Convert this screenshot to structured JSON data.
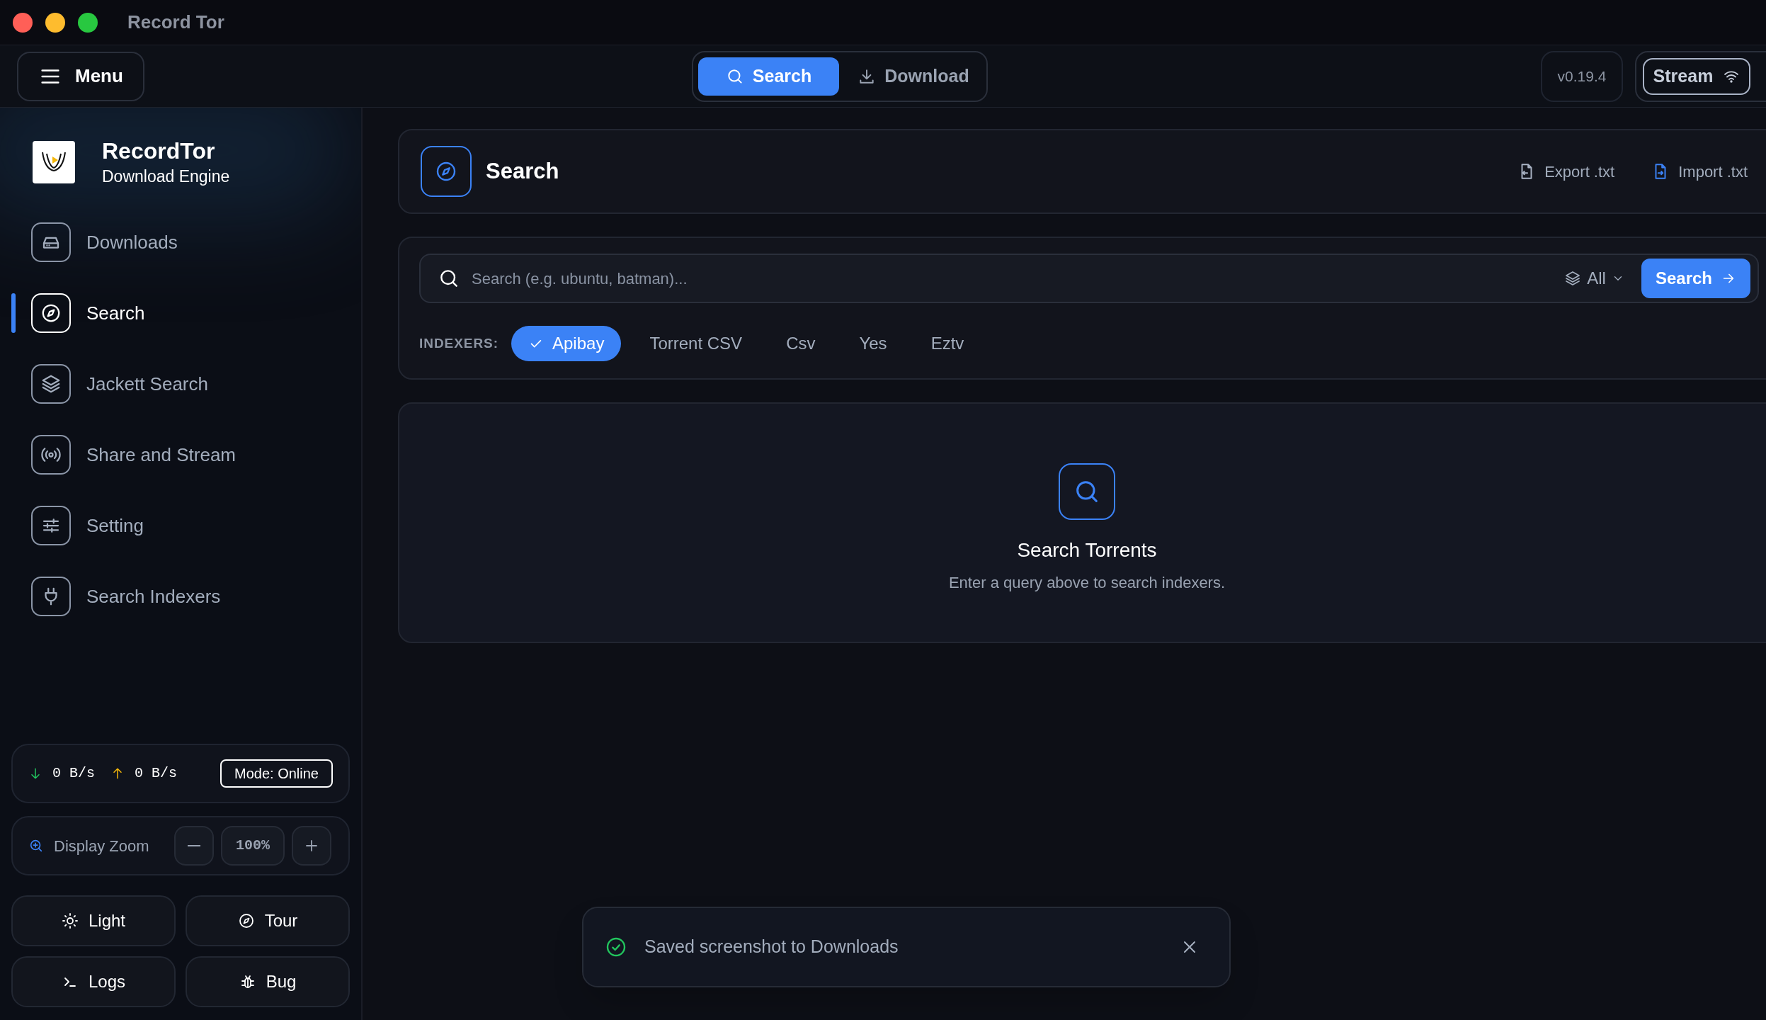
{
  "window": {
    "title": "Record Tor"
  },
  "toolbar": {
    "menu_button": "Menu",
    "mode_tabs": [
      {
        "label": "Search",
        "selected": true
      },
      {
        "label": "Download",
        "selected": false
      }
    ],
    "version": "v0.19.4",
    "stream_button": "Stream"
  },
  "sidebar": {
    "brand": {
      "name": "RecordTor",
      "subtitle": "Download Engine"
    },
    "nav": [
      {
        "label": "Downloads",
        "selected": false
      },
      {
        "label": "Search",
        "selected": true
      },
      {
        "label": "Jackett Search",
        "selected": false
      },
      {
        "label": "Share and Stream",
        "selected": false
      },
      {
        "label": "Setting",
        "selected": false
      },
      {
        "label": "Search Indexers",
        "selected": false
      }
    ],
    "stats": {
      "down": "0 B/s",
      "up": "0 B/s",
      "mode": "Mode: Online"
    },
    "zoom": {
      "label": "Display Zoom",
      "value": "100%"
    },
    "actions": [
      {
        "label": "Light"
      },
      {
        "label": "Tour"
      },
      {
        "label": "Logs"
      },
      {
        "label": "Bug"
      }
    ]
  },
  "page_header": {
    "title": "Search",
    "actions": [
      {
        "label": "Export .txt"
      },
      {
        "label": "Import .txt"
      }
    ]
  },
  "search": {
    "placeholder": "Search (e.g. ubuntu, batman)...",
    "category": "All",
    "button": "Search",
    "indexers_label": "INDEXERS:",
    "indexers": [
      {
        "label": "Apibay",
        "selected": true
      },
      {
        "label": "Torrent CSV",
        "selected": false
      },
      {
        "label": "Csv",
        "selected": false
      },
      {
        "label": "Yes",
        "selected": false
      },
      {
        "label": "Eztv",
        "selected": false
      }
    ]
  },
  "empty_state": {
    "title": "Search Torrents",
    "text": "Enter a query above to search indexers."
  },
  "toast": {
    "message": "Saved screenshot to Downloads"
  }
}
